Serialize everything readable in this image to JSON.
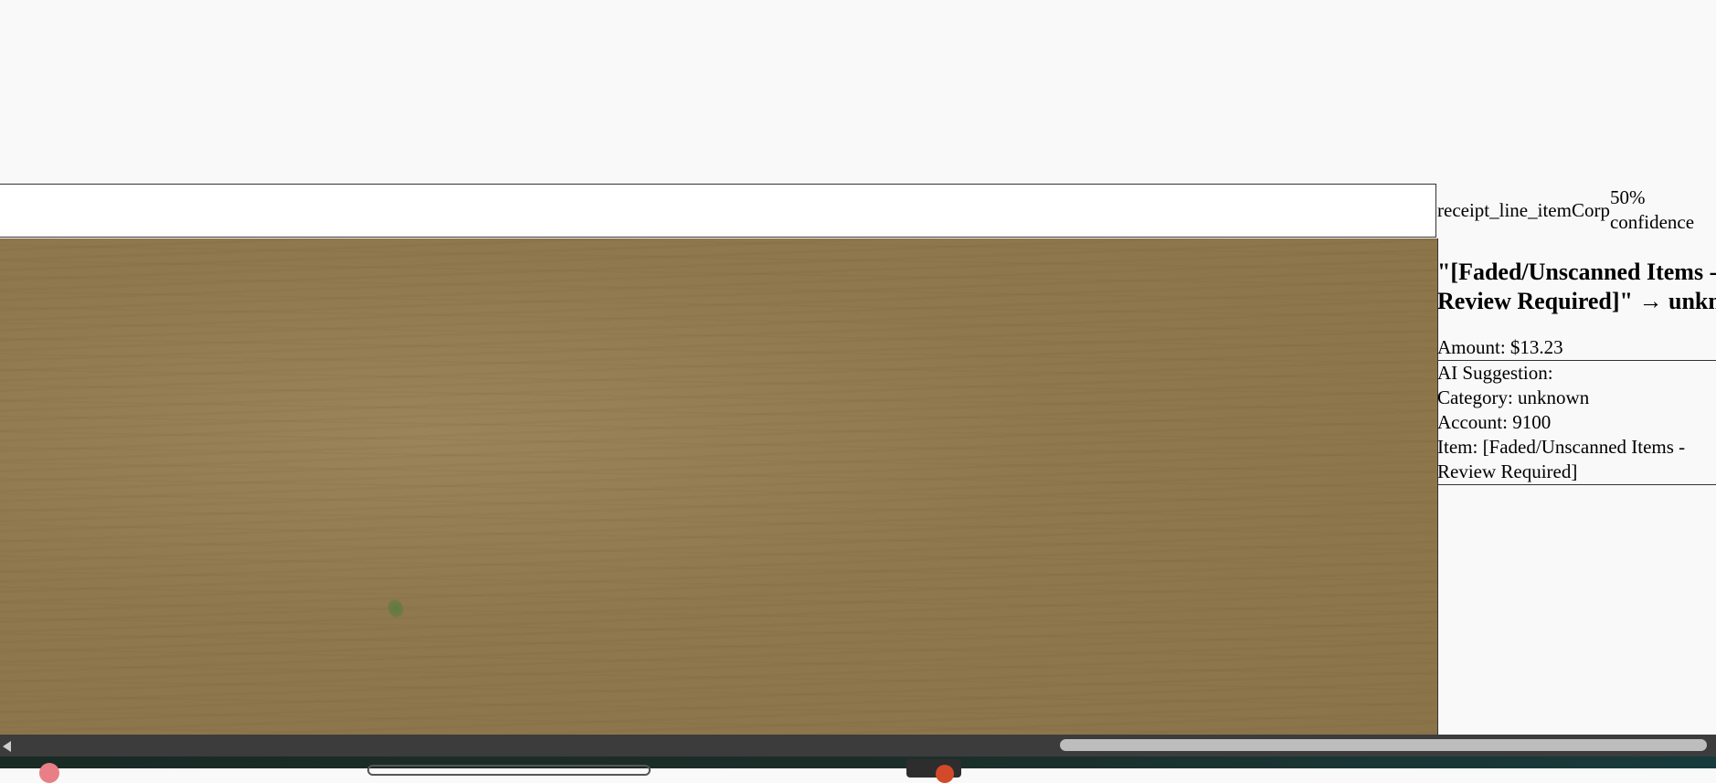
{
  "item": {
    "type": "receipt_line_item",
    "vendor": "Corp",
    "confidence": "50% confidence",
    "title": "\"[Faded/Unscanned Items - Review Required]\" → unknown",
    "amount": "Amount: $13.23"
  },
  "suggestion": {
    "heading": "AI Suggestion:",
    "category": "Category: unknown",
    "account": "Account: 9100",
    "item": "Item: [Faded/Unscanned Items - Review Required]"
  },
  "colors": {
    "page_background": "#f9f9f9",
    "receipt_paper": "#8f774d",
    "scrollbar_track": "#3c3c3c",
    "scrollbar_thumb": "#bdbdbd"
  },
  "icons": {
    "scroll_left": "scroll-left-arrow-icon"
  }
}
